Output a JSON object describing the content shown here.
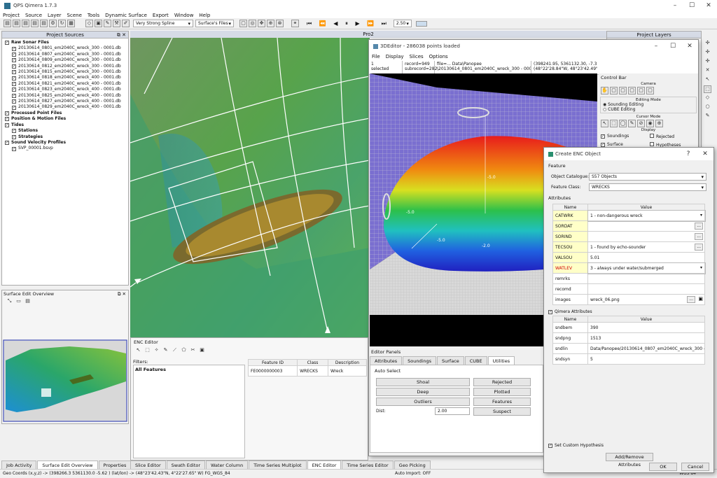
{
  "app": {
    "title": "QPS Qimera 1.7.3",
    "menu": [
      "Project",
      "Source",
      "Layer",
      "Scene",
      "Tools",
      "Dynamic Surface",
      "Export",
      "Window",
      "Help"
    ],
    "toolbar": {
      "spline": "Very Strong Spline",
      "surface": "Surface's Files",
      "speed": "2.50"
    }
  },
  "project_sources": {
    "title": "Project Sources",
    "items": [
      {
        "label": "Raw Sonar Files",
        "level": 0,
        "bold": true
      },
      {
        "label": "20130614_0801_em2040C_wreck_300 - 0001.db",
        "level": 1
      },
      {
        "label": "20130614_0807_em2040C_wreck_300 - 0001.db",
        "level": 1
      },
      {
        "label": "20130614_0809_em2040C_wreck_300 - 0001.db",
        "level": 1
      },
      {
        "label": "20130614_0812_em2040C_wreck_300 - 0001.db",
        "level": 1
      },
      {
        "label": "20130614_0815_em2040C_wreck_300 - 0001.db",
        "level": 1
      },
      {
        "label": "20130614_0818_em2040C_wreck_400 - 0001.db",
        "level": 1
      },
      {
        "label": "20130614_0821_em2040C_wreck_400 - 0001.db",
        "level": 1
      },
      {
        "label": "20130614_0823_em2040C_wreck_400 - 0001.db",
        "level": 1
      },
      {
        "label": "20130614_0825_em2040C_wreck_400 - 0001.db",
        "level": 1
      },
      {
        "label": "20130614_0827_em2040C_wreck_400 - 0001.db",
        "level": 1
      },
      {
        "label": "20130614_0829_em2040C_wreck_400 - 0001.db",
        "level": 1
      },
      {
        "label": "Processed Point Files",
        "level": 0,
        "bold": true
      },
      {
        "label": "Position & Motion Files",
        "level": 0,
        "bold": true
      },
      {
        "label": "Tides",
        "level": 0,
        "bold": true
      },
      {
        "label": "Stations",
        "level": 1,
        "bold": true
      },
      {
        "label": "Strategies",
        "level": 1,
        "bold": true
      },
      {
        "label": "Sound Velocity Profiles",
        "level": 0,
        "bold": true
      },
      {
        "label": "SVP_00001.bsvp",
        "level": 1
      }
    ]
  },
  "surface_overview": {
    "title": "Surface Edit Overview"
  },
  "left_tabs": [
    "Job Activity",
    "Surface Edit Overview",
    "Properties"
  ],
  "scene": {
    "title": "Pro2"
  },
  "project_layers": {
    "title": "Project Layers"
  },
  "editor3d": {
    "title": "3DEditor - 286038 points loaded",
    "menu": [
      "File",
      "Display",
      "Slices",
      "Options"
    ],
    "info": {
      "selected": "1",
      "selected_label": "selected",
      "record": "record=949",
      "subrecord": "subrecord=282",
      "file": "file=... Data\\Panopee",
      "file2": "\\20130614_0801_em2040C_wreck_300 - 0001.qpd",
      "coords": "(398241.95, 5361132.30, -7.33)",
      "coords2": "(48°22'28.84\"W, 48°23'42.49\"N,"
    },
    "control_bar": {
      "title": "Control Bar",
      "camera": "Camera",
      "editing_mode": "Editing Mode",
      "sounding_editing": "Sounding Editing",
      "cube_editing": "CUBE Editing",
      "cursor_mode": "Cursor Mode",
      "display": "Display",
      "soundings": "Soundings",
      "rejected": "Rejected",
      "surface": "Surface",
      "hypotheses": "Hypotheses"
    },
    "panels_title": "Editor Panels",
    "tabs": [
      "Attributes",
      "Soundings",
      "Surface",
      "CUBE",
      "Utilities"
    ],
    "auto_select": "Auto Select",
    "buttons": [
      "Shoal",
      "Rejected",
      "Deep",
      "Plotted",
      "Outliers",
      "Features",
      "Suspect"
    ],
    "dist_label": "Dist:",
    "dist_value": "2.00",
    "depth_labels": [
      "-5.0",
      "-5.0",
      "-2.0",
      "-5.0"
    ]
  },
  "enc_editor": {
    "title": "ENC Editor",
    "filters_label": "Filters:",
    "all_features": "All Features",
    "columns": [
      "Feature ID",
      "Class",
      "Description"
    ],
    "row": [
      "FE0000000003",
      "WRECKS",
      "Wreck"
    ]
  },
  "bottom_tabs": [
    "Slice Editor",
    "Swath Editor",
    "Water Column",
    "Time Series Multiplot",
    "ENC Editor",
    "Time Series Editor",
    "Geo Picking"
  ],
  "status": {
    "geo": "Geo Coords (x,y,z) -> (398266.3 5361130.0 -5.62 )  (lat/lon) -> (48°23'42.43\"N, 4°22'27.65\" W) FG_WGS_84",
    "auto_import": "Auto Import: OFF",
    "right": "WGS 84"
  },
  "enc_dialog": {
    "title": "Create ENC Object",
    "feature": "Feature",
    "object_catalogue_label": "Object Catalogue:",
    "object_catalogue": "S57 Objects",
    "feature_class_label": "Feature Class:",
    "feature_class": "WRECKS",
    "attributes": "Attributes",
    "col_name": "Name",
    "col_value": "Value",
    "rows": [
      {
        "name": "CATWRK",
        "value": "1 - non-dangerous wreck",
        "kind": "combo",
        "color": "#ffffc8"
      },
      {
        "name": "SORDAT",
        "value": "",
        "kind": "dots",
        "color": "#ffffc8"
      },
      {
        "name": "SORIND",
        "value": "",
        "kind": "dots",
        "color": "#ffffc8"
      },
      {
        "name": "TECSOU",
        "value": "1 - found by echo-sounder",
        "kind": "dots",
        "color": "#ffffc8"
      },
      {
        "name": "VALSOU",
        "value": "5.01",
        "kind": "text",
        "color": "#ffffc8"
      },
      {
        "name": "WATLEV",
        "value": "3 - always under water/submerged",
        "kind": "combo",
        "color": "#ffffc8",
        "red": true
      },
      {
        "name": "remrks",
        "value": "",
        "kind": "text",
        "color": "#ffffff"
      },
      {
        "name": "recomd",
        "value": "",
        "kind": "text",
        "color": "#ffffff"
      },
      {
        "name": "images",
        "value": "wreck_06.png",
        "kind": "img",
        "color": "#ffffff"
      }
    ],
    "qimera_attributes": "Qimera Attributes",
    "qrows": [
      {
        "name": "sndbem",
        "value": "390"
      },
      {
        "name": "sndpng",
        "value": "1513"
      },
      {
        "name": "sndlin",
        "value": "Data/Panopee/20130614_0807_em2040C_wreck_300 - 0001.qpd"
      },
      {
        "name": "sndsyn",
        "value": "5"
      }
    ],
    "set_custom": "Set Custom Hypothesis",
    "add_remove": "Add/Remove Attributes",
    "ok": "OK",
    "cancel": "Cancel"
  }
}
